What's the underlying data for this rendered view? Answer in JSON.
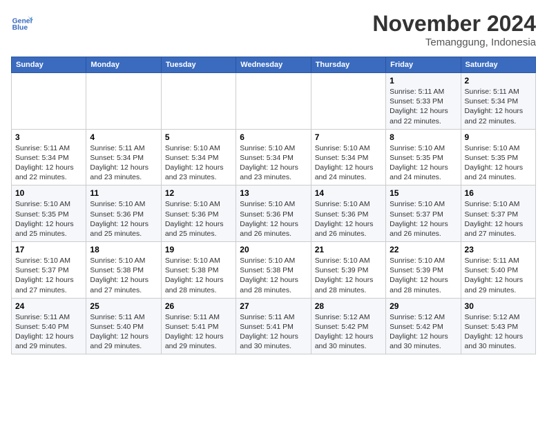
{
  "header": {
    "logo_line1": "General",
    "logo_line2": "Blue",
    "title": "November 2024",
    "subtitle": "Temanggung, Indonesia"
  },
  "calendar": {
    "days_of_week": [
      "Sunday",
      "Monday",
      "Tuesday",
      "Wednesday",
      "Thursday",
      "Friday",
      "Saturday"
    ],
    "weeks": [
      [
        {
          "day": "",
          "info": ""
        },
        {
          "day": "",
          "info": ""
        },
        {
          "day": "",
          "info": ""
        },
        {
          "day": "",
          "info": ""
        },
        {
          "day": "",
          "info": ""
        },
        {
          "day": "1",
          "info": "Sunrise: 5:11 AM\nSunset: 5:33 PM\nDaylight: 12 hours\nand 22 minutes."
        },
        {
          "day": "2",
          "info": "Sunrise: 5:11 AM\nSunset: 5:34 PM\nDaylight: 12 hours\nand 22 minutes."
        }
      ],
      [
        {
          "day": "3",
          "info": "Sunrise: 5:11 AM\nSunset: 5:34 PM\nDaylight: 12 hours\nand 22 minutes."
        },
        {
          "day": "4",
          "info": "Sunrise: 5:11 AM\nSunset: 5:34 PM\nDaylight: 12 hours\nand 23 minutes."
        },
        {
          "day": "5",
          "info": "Sunrise: 5:10 AM\nSunset: 5:34 PM\nDaylight: 12 hours\nand 23 minutes."
        },
        {
          "day": "6",
          "info": "Sunrise: 5:10 AM\nSunset: 5:34 PM\nDaylight: 12 hours\nand 23 minutes."
        },
        {
          "day": "7",
          "info": "Sunrise: 5:10 AM\nSunset: 5:34 PM\nDaylight: 12 hours\nand 24 minutes."
        },
        {
          "day": "8",
          "info": "Sunrise: 5:10 AM\nSunset: 5:35 PM\nDaylight: 12 hours\nand 24 minutes."
        },
        {
          "day": "9",
          "info": "Sunrise: 5:10 AM\nSunset: 5:35 PM\nDaylight: 12 hours\nand 24 minutes."
        }
      ],
      [
        {
          "day": "10",
          "info": "Sunrise: 5:10 AM\nSunset: 5:35 PM\nDaylight: 12 hours\nand 25 minutes."
        },
        {
          "day": "11",
          "info": "Sunrise: 5:10 AM\nSunset: 5:36 PM\nDaylight: 12 hours\nand 25 minutes."
        },
        {
          "day": "12",
          "info": "Sunrise: 5:10 AM\nSunset: 5:36 PM\nDaylight: 12 hours\nand 25 minutes."
        },
        {
          "day": "13",
          "info": "Sunrise: 5:10 AM\nSunset: 5:36 PM\nDaylight: 12 hours\nand 26 minutes."
        },
        {
          "day": "14",
          "info": "Sunrise: 5:10 AM\nSunset: 5:36 PM\nDaylight: 12 hours\nand 26 minutes."
        },
        {
          "day": "15",
          "info": "Sunrise: 5:10 AM\nSunset: 5:37 PM\nDaylight: 12 hours\nand 26 minutes."
        },
        {
          "day": "16",
          "info": "Sunrise: 5:10 AM\nSunset: 5:37 PM\nDaylight: 12 hours\nand 27 minutes."
        }
      ],
      [
        {
          "day": "17",
          "info": "Sunrise: 5:10 AM\nSunset: 5:37 PM\nDaylight: 12 hours\nand 27 minutes."
        },
        {
          "day": "18",
          "info": "Sunrise: 5:10 AM\nSunset: 5:38 PM\nDaylight: 12 hours\nand 27 minutes."
        },
        {
          "day": "19",
          "info": "Sunrise: 5:10 AM\nSunset: 5:38 PM\nDaylight: 12 hours\nand 28 minutes."
        },
        {
          "day": "20",
          "info": "Sunrise: 5:10 AM\nSunset: 5:38 PM\nDaylight: 12 hours\nand 28 minutes."
        },
        {
          "day": "21",
          "info": "Sunrise: 5:10 AM\nSunset: 5:39 PM\nDaylight: 12 hours\nand 28 minutes."
        },
        {
          "day": "22",
          "info": "Sunrise: 5:10 AM\nSunset: 5:39 PM\nDaylight: 12 hours\nand 28 minutes."
        },
        {
          "day": "23",
          "info": "Sunrise: 5:11 AM\nSunset: 5:40 PM\nDaylight: 12 hours\nand 29 minutes."
        }
      ],
      [
        {
          "day": "24",
          "info": "Sunrise: 5:11 AM\nSunset: 5:40 PM\nDaylight: 12 hours\nand 29 minutes."
        },
        {
          "day": "25",
          "info": "Sunrise: 5:11 AM\nSunset: 5:40 PM\nDaylight: 12 hours\nand 29 minutes."
        },
        {
          "day": "26",
          "info": "Sunrise: 5:11 AM\nSunset: 5:41 PM\nDaylight: 12 hours\nand 29 minutes."
        },
        {
          "day": "27",
          "info": "Sunrise: 5:11 AM\nSunset: 5:41 PM\nDaylight: 12 hours\nand 30 minutes."
        },
        {
          "day": "28",
          "info": "Sunrise: 5:12 AM\nSunset: 5:42 PM\nDaylight: 12 hours\nand 30 minutes."
        },
        {
          "day": "29",
          "info": "Sunrise: 5:12 AM\nSunset: 5:42 PM\nDaylight: 12 hours\nand 30 minutes."
        },
        {
          "day": "30",
          "info": "Sunrise: 5:12 AM\nSunset: 5:43 PM\nDaylight: 12 hours\nand 30 minutes."
        }
      ]
    ]
  }
}
